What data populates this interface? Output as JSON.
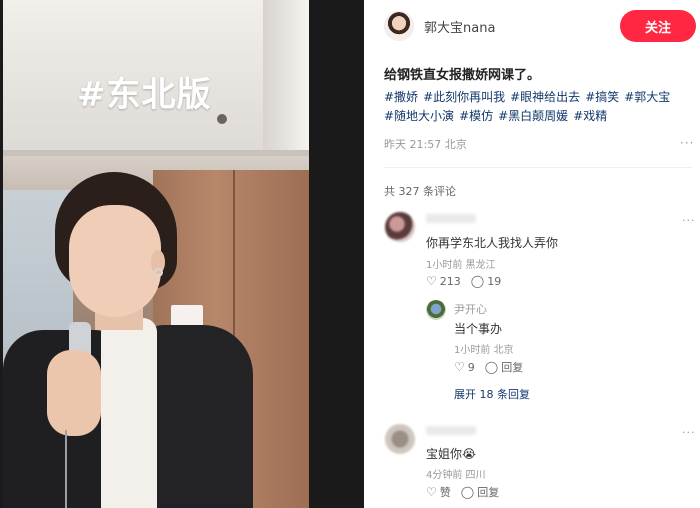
{
  "video": {
    "overlay_tag": "#东北版"
  },
  "author": {
    "name": "郭大宝nana",
    "follow_label": "关注"
  },
  "post": {
    "title": "给钢铁直女报撒娇网课了。",
    "hashtags": [
      "#撒娇",
      "#此刻你再叫我",
      "#眼神给出去",
      "#搞笑",
      "#郭大宝",
      "#随地大小演",
      "#模仿",
      "#黑白颠周媛",
      "#戏精"
    ],
    "meta": "昨天 21:57 北京",
    "more_icon": "more-dots-icon"
  },
  "comments": {
    "count_label": "共 327 条评论",
    "items": [
      {
        "text": "你再学东北人我找人弄你",
        "meta": "1小时前 黑龙江",
        "likes": "213",
        "replies": "19",
        "reply": {
          "name": "尹开心",
          "text": "当个事办",
          "meta": "1小时前 北京",
          "likes": "9",
          "reply_label": "回复"
        },
        "expand_label": "展开 18 条回复"
      },
      {
        "text": "宝姐你",
        "emoji": "😭",
        "meta": "4分钟前 四川",
        "like_label": "赞",
        "reply_label": "回复"
      }
    ]
  },
  "icons": {
    "like": "heart-outline-icon",
    "reply": "speech-bubble-icon"
  },
  "colors": {
    "accent": "#ff2741",
    "link": "#13386c"
  }
}
